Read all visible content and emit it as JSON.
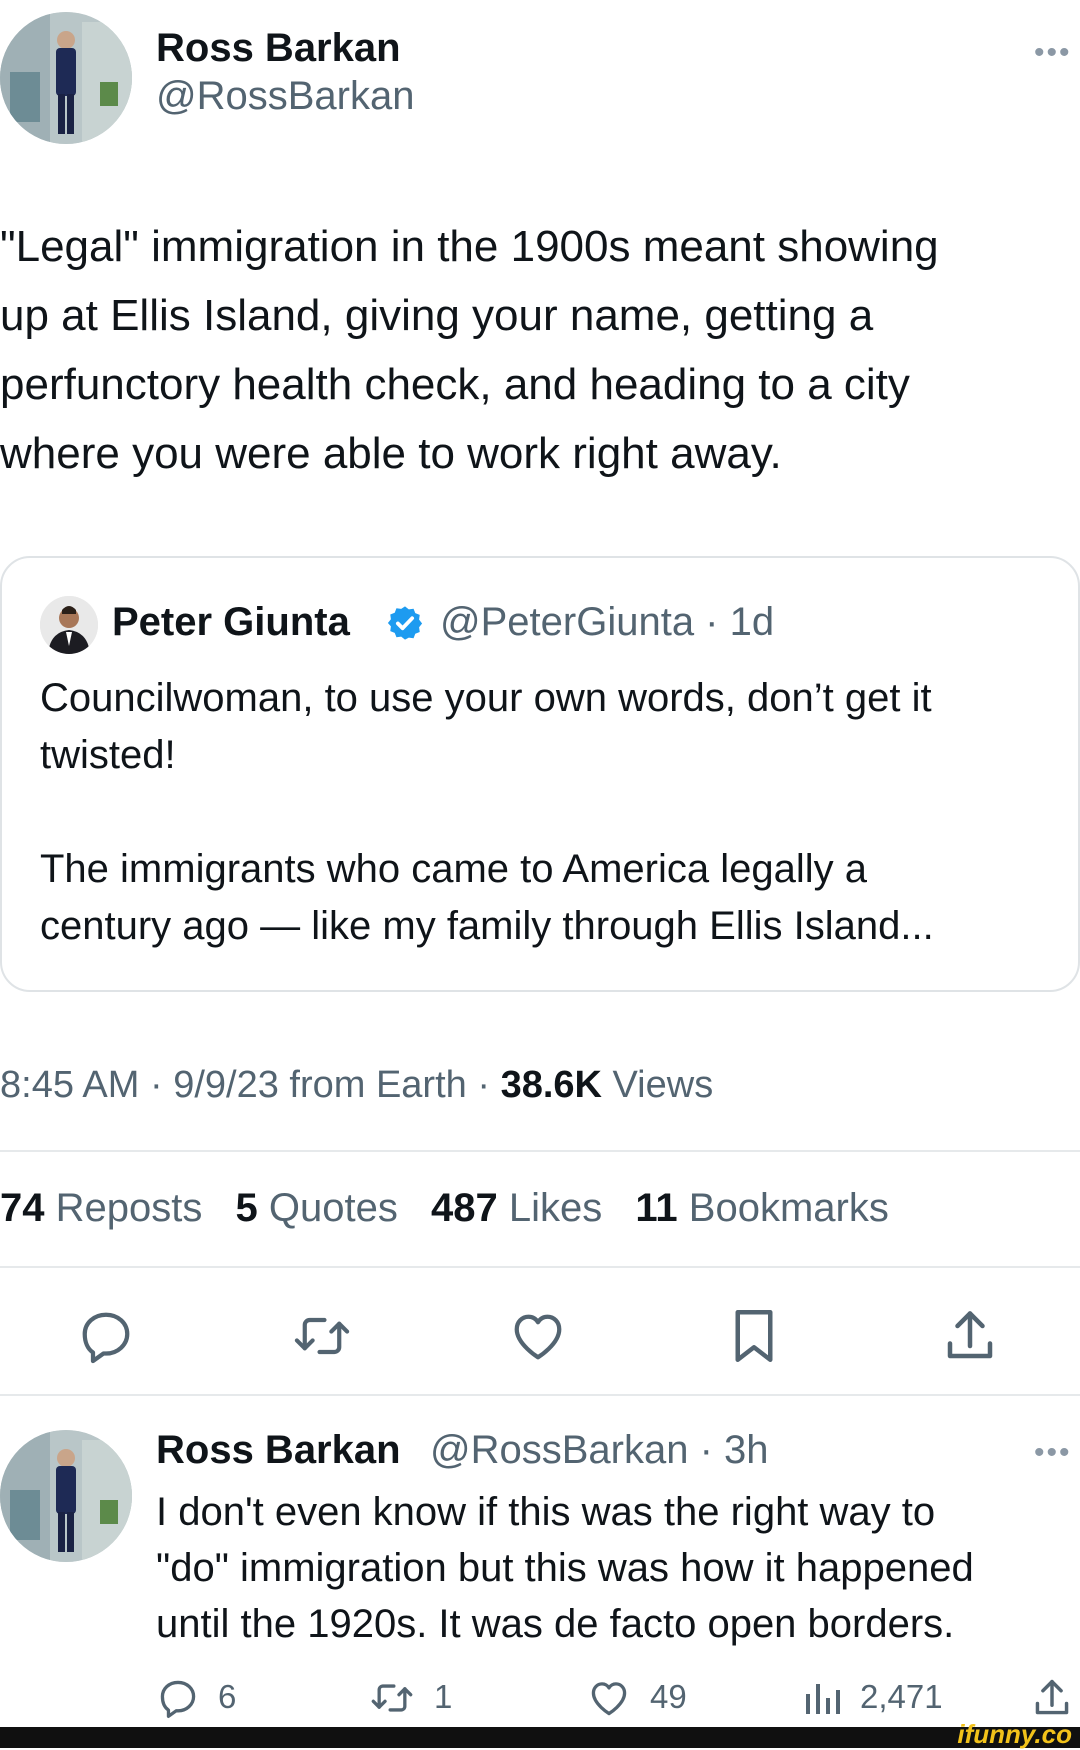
{
  "tweet": {
    "author_name": "Ross Barkan",
    "author_handle": "@RossBarkan",
    "more": "•••",
    "text_lines": [
      "\"Legal\" immigration in the 1900s meant showing",
      "up at Ellis Island, giving your name, getting a",
      "perfunctory health check, and heading to a city",
      "where you were able to work right away."
    ]
  },
  "quote": {
    "author_name": "Peter Giunta",
    "handle_time": "@PeterGiunta · 1d",
    "text_lines": [
      "Councilwoman, to use your own words, don’t get it",
      "twisted!",
      "",
      "The immigrants who came to America legally a",
      "century ago — like my family through Ellis Island..."
    ]
  },
  "meta": {
    "time_prefix": "8:45 AM · 9/9/23 from Earth · ",
    "views_count": "38.6K",
    "views_label": " Views"
  },
  "stats": {
    "reposts_count": "74",
    "reposts_label": "Reposts",
    "quotes_count": "5",
    "quotes_label": "Quotes",
    "likes_count": "487",
    "likes_label": "Likes",
    "bookmarks_count": "11",
    "bookmarks_label": "Bookmarks"
  },
  "action_icons": [
    "reply-icon",
    "repost-icon",
    "like-icon",
    "bookmark-icon",
    "share-icon"
  ],
  "reply": {
    "author_name": "Ross Barkan",
    "handle_time": "@RossBarkan · 3h",
    "more": "•••",
    "text_lines": [
      "I don't even know if this was the right way to",
      "\"do\" immigration but this was how it happened",
      "until the 1920s. It was de facto open borders."
    ],
    "reply_count": "6",
    "repost_count": "1",
    "like_count": "49",
    "views_count": "2,471"
  },
  "watermark": "ifunny.co",
  "colors": {
    "text": "#0f1419",
    "secondary": "#536471",
    "verified": "#1d9bf0",
    "border": "#dfe3e6"
  }
}
